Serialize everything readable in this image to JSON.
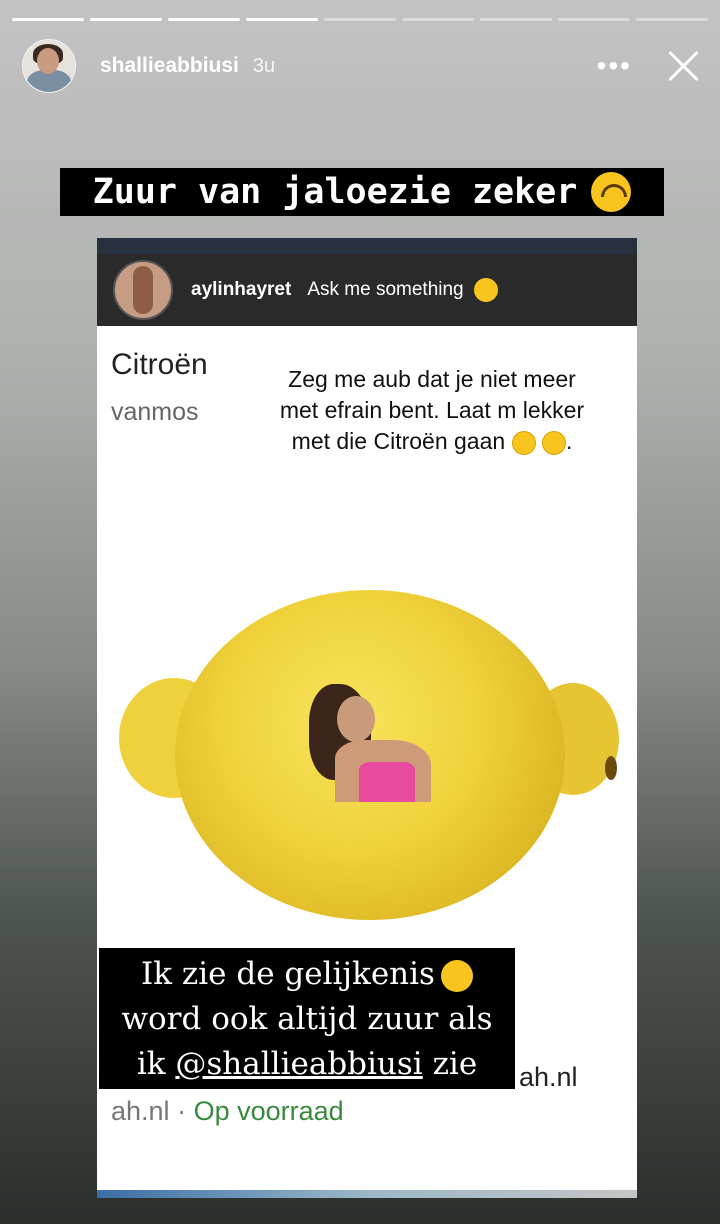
{
  "story": {
    "progress": {
      "segments": 9,
      "completed": 4
    },
    "user": {
      "username": "shallieabbiusi",
      "time": "3u"
    },
    "more_label": "•••",
    "top_caption": "Zuur van jaloezie zeker"
  },
  "question": {
    "asker": "aylinhayret",
    "prompt": "Ask me something",
    "product_name": "Citroën",
    "product_sub": "vanmos",
    "answer": {
      "line1": "Zeg me aub dat je niet meer",
      "line2": "met efrain bent. Laat m lekker",
      "line3": "met die Citroën gaan",
      "end": "."
    }
  },
  "bottom_caption": {
    "line1": "Ik zie de gelijkenis",
    "line2": "word ook altijd zuur als",
    "line3_pre": "ik",
    "mention": "@shallieabbiusi",
    "line3_post": "zie"
  },
  "shop": {
    "site": "ah.nl",
    "stock_site": "ah.nl",
    "separator": " · ",
    "availability": "Op voorraad"
  }
}
